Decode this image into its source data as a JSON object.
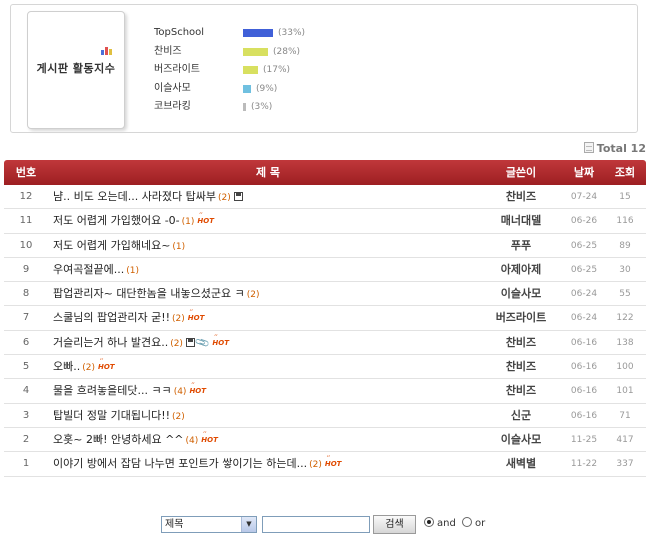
{
  "activity": {
    "title": "게시판 활동지수",
    "ranks": [
      {
        "name": "TopSchool",
        "pct": "(33%)",
        "value": 33,
        "color": "#4060d8"
      },
      {
        "name": "찬비즈",
        "pct": "(28%)",
        "value": 28,
        "color": "#d8e060"
      },
      {
        "name": "버즈라이트",
        "pct": "(17%)",
        "value": 17,
        "color": "#d8e060"
      },
      {
        "name": "이슬사모",
        "pct": "(9%)",
        "value": 9,
        "color": "#70c0e0"
      },
      {
        "name": "코브라킹",
        "pct": "(3%)",
        "value": 3,
        "color": "#bbbbbb"
      }
    ]
  },
  "total": "Total 12",
  "table": {
    "headers": {
      "no": "번호",
      "title": "제 목",
      "author": "글쓴이",
      "date": "날짜",
      "views": "조회"
    },
    "rows": [
      {
        "no": "12",
        "title": "냠.. 비도 오는데... 사라졌다 탑싸부",
        "comments": "(2)",
        "hot": false,
        "disk": true,
        "clip": false,
        "author": "찬비즈",
        "date": "07-24",
        "views": "15"
      },
      {
        "no": "11",
        "title": "저도 어렵게 가입했어요 -0-",
        "comments": "(1)",
        "hot": true,
        "disk": false,
        "clip": false,
        "author": "매너대델",
        "date": "06-26",
        "views": "116"
      },
      {
        "no": "10",
        "title": "저도 어렵게 가입해네요~",
        "comments": "(1)",
        "hot": false,
        "disk": false,
        "clip": false,
        "author": "푸푸",
        "date": "06-25",
        "views": "89"
      },
      {
        "no": "9",
        "title": "우여곡절끝에...",
        "comments": "(1)",
        "hot": false,
        "disk": false,
        "clip": false,
        "author": "아제아제",
        "date": "06-25",
        "views": "30"
      },
      {
        "no": "8",
        "title": "팝업관리자~ 대단한놈을 내놓으셨군요 ㅋ",
        "comments": "(2)",
        "hot": false,
        "disk": false,
        "clip": false,
        "author": "이슬사모",
        "date": "06-24",
        "views": "55"
      },
      {
        "no": "7",
        "title": "스쿨님의 팝업관리자 굳!!",
        "comments": "(2)",
        "hot": true,
        "disk": false,
        "clip": false,
        "author": "버즈라이트",
        "date": "06-24",
        "views": "122"
      },
      {
        "no": "6",
        "title": "거슬리는거 하나 발견요..",
        "comments": "(2)",
        "hot": true,
        "disk": true,
        "clip": true,
        "author": "찬비즈",
        "date": "06-16",
        "views": "138"
      },
      {
        "no": "5",
        "title": "오빠..",
        "comments": "(2)",
        "hot": true,
        "disk": false,
        "clip": false,
        "author": "찬비즈",
        "date": "06-16",
        "views": "100"
      },
      {
        "no": "4",
        "title": "물을 흐려놓을테닷... ㅋㅋ",
        "comments": "(4)",
        "hot": true,
        "disk": false,
        "clip": false,
        "author": "찬비즈",
        "date": "06-16",
        "views": "101"
      },
      {
        "no": "3",
        "title": "탑빌더 정말 기대됩니다!!",
        "comments": "(2)",
        "hot": false,
        "disk": false,
        "clip": false,
        "author": "신군",
        "date": "06-16",
        "views": "71"
      },
      {
        "no": "2",
        "title": "오홋~ 2빠! 안녕하세요 ^^",
        "comments": "(4)",
        "hot": true,
        "disk": false,
        "clip": false,
        "author": "이슬사모",
        "date": "11-25",
        "views": "417"
      },
      {
        "no": "1",
        "title": "이야기 방에서 잡담 나누면 포인트가 쌓이기는 하는데...",
        "comments": "(2)",
        "hot": true,
        "disk": false,
        "clip": false,
        "author": "새벽별",
        "date": "11-22",
        "views": "337"
      }
    ]
  },
  "hot_label": "HOT",
  "search": {
    "field": "제목",
    "query": "",
    "button": "검색",
    "and_label": "and",
    "or_label": "or",
    "mode": "and"
  }
}
